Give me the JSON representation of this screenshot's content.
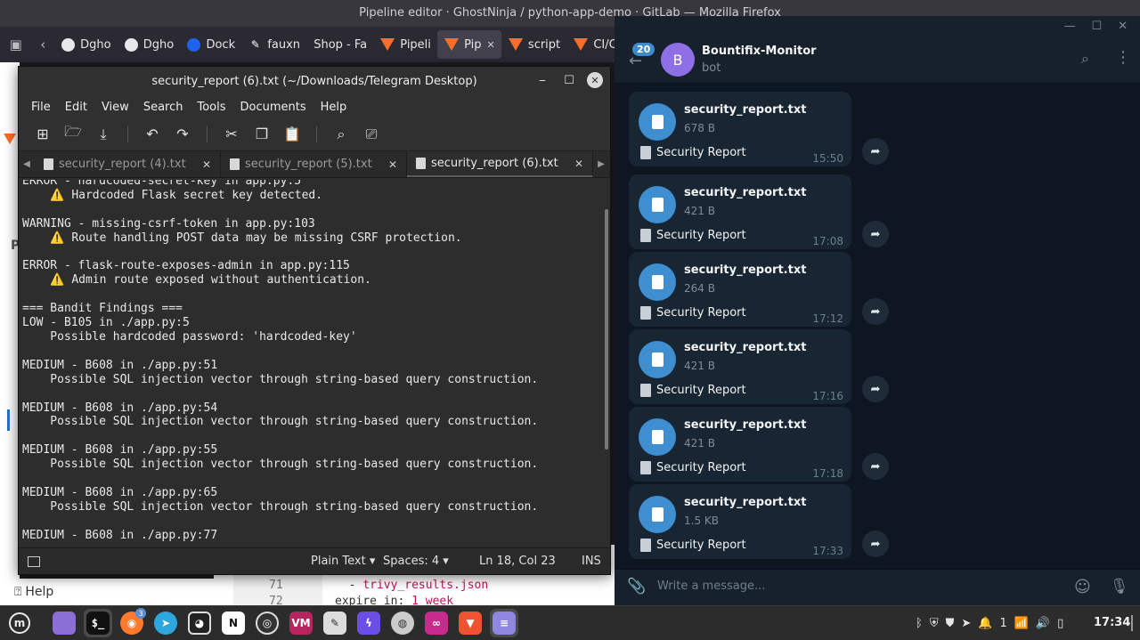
{
  "firefox": {
    "window_title": "Pipeline editor · GhostNinja / python-app-demo · GitLab — Mozilla Firefox",
    "tabs": [
      {
        "label": "Dgho",
        "icon": "github-icon"
      },
      {
        "label": "Dgho",
        "icon": "github-icon"
      },
      {
        "label": "Dock",
        "icon": "docker-icon"
      },
      {
        "label": "fauxn",
        "icon": "faux-icon"
      },
      {
        "label": "Shop - Fa",
        "icon": "shop-icon"
      },
      {
        "label": "Pipeli",
        "icon": "gitlab-icon"
      },
      {
        "label": "Pip",
        "icon": "gitlab-icon",
        "active": true
      },
      {
        "label": "script",
        "icon": "gitlab-icon"
      },
      {
        "label": "CI/C",
        "icon": "gitlab-icon"
      }
    ],
    "help_label": "Help",
    "code": {
      "line_numbers": [
        "71",
        "72"
      ],
      "line1_prefix": "  - ",
      "line1_value": "trivy_results.json",
      "line2_key": "expire_in: ",
      "line2_value": "1 week"
    }
  },
  "gedit": {
    "title": "security_report (6).txt (~/Downloads/Telegram Desktop)",
    "menu": [
      "File",
      "Edit",
      "View",
      "Search",
      "Tools",
      "Documents",
      "Help"
    ],
    "tabs": [
      {
        "label": "security_report (4).txt"
      },
      {
        "label": "security_report (5).txt"
      },
      {
        "label": "security_report (6).txt",
        "active": true
      }
    ],
    "content": "ERROR - hardcoded-secret-key in app.py:5\n    ⚠️ Hardcoded Flask secret key detected.\n\nWARNING - missing-csrf-token in app.py:103\n    ⚠️ Route handling POST data may be missing CSRF protection.\n\nERROR - flask-route-exposes-admin in app.py:115\n    ⚠️ Admin route exposed without authentication.\n\n=== Bandit Findings ===\nLOW - B105 in ./app.py:5\n    Possible hardcoded password: 'hardcoded-key'\n\nMEDIUM - B608 in ./app.py:51\n    Possible SQL injection vector through string-based query construction.\n\nMEDIUM - B608 in ./app.py:54\n    Possible SQL injection vector through string-based query construction.\n\nMEDIUM - B608 in ./app.py:55\n    Possible SQL injection vector through string-based query construction.\n\nMEDIUM - B608 in ./app.py:65\n    Possible SQL injection vector through string-based query construction.\n\nMEDIUM - B608 in ./app.py:77",
    "status": {
      "language": "Plain Text",
      "spaces": "Spaces: 4",
      "position": "Ln 18, Col 23",
      "mode": "INS"
    }
  },
  "telegram": {
    "chat_name": "Bountifix-Monitor",
    "chat_status": "bot",
    "avatar_letter": "B",
    "unread_badge": "20",
    "input_placeholder": "Write a message...",
    "messages": [
      {
        "file": "security_report.txt",
        "size": "678 B",
        "caption": "Security Report",
        "time": "15:50"
      },
      {
        "file": "security_report.txt",
        "size": "421 B",
        "caption": "Security Report",
        "time": "17:08"
      },
      {
        "file": "security_report.txt",
        "size": "264 B",
        "caption": "Security Report",
        "time": "17:12"
      },
      {
        "file": "security_report.txt",
        "size": "421 B",
        "caption": "Security Report",
        "time": "17:16"
      },
      {
        "file": "security_report.txt",
        "size": "421 B",
        "caption": "Security Report",
        "time": "17:18"
      },
      {
        "file": "security_report.txt",
        "size": "1.5 KB",
        "caption": "Security Report",
        "time": "17:33"
      }
    ]
  },
  "taskbar": {
    "clock": "17:34",
    "notification_count": "3",
    "tray_number": "1"
  },
  "colors": {
    "telegram_bg": "#0e1621",
    "telegram_bubble": "#182533",
    "telegram_accent": "#3e8ed0",
    "gitlab_orange": "#fc6d26",
    "gedit_bg": "#2d2d2d"
  }
}
